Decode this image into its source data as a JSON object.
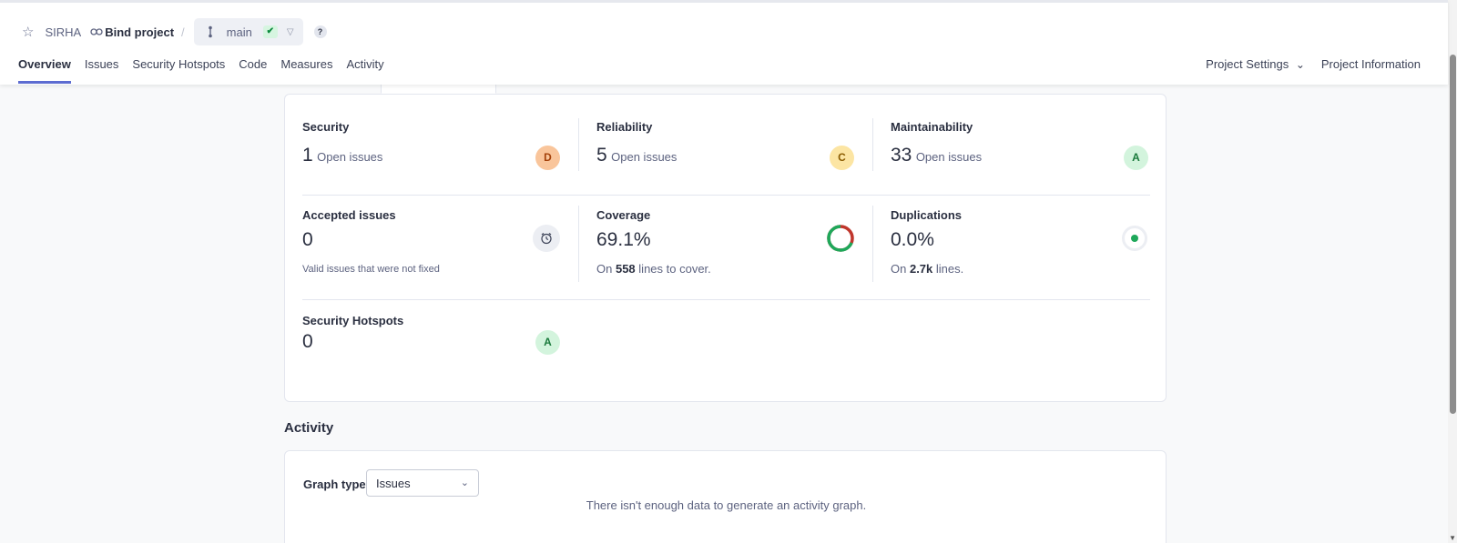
{
  "breadcrumb": {
    "project": "SIRHA",
    "bind_label": "Bind project",
    "separator": "/",
    "branch": "main",
    "qg_status_mark": "✔",
    "help": "?"
  },
  "nav": {
    "tabs": [
      "Overview",
      "Issues",
      "Security Hotspots",
      "Code",
      "Measures",
      "Activity"
    ],
    "active": "Overview",
    "right": {
      "settings": "Project Settings",
      "settings_chev": "⌄",
      "info": "Project Information"
    }
  },
  "metrics": {
    "security": {
      "title": "Security",
      "count": "1",
      "suffix": "Open issues",
      "rating": "D",
      "rating_color": "#f9c59b",
      "rating_text": "#a4410a"
    },
    "reliability": {
      "title": "Reliability",
      "count": "5",
      "suffix": "Open issues",
      "rating": "C",
      "rating_color": "#fce5a3",
      "rating_text": "#8a5b00"
    },
    "maintainability": {
      "title": "Maintainability",
      "count": "33",
      "suffix": "Open issues",
      "rating": "A",
      "rating_color": "#d3f4dd",
      "rating_text": "#1a7a3c"
    },
    "accepted": {
      "title": "Accepted issues",
      "value": "0",
      "note": "Valid issues that were not fixed"
    },
    "coverage": {
      "title": "Coverage",
      "value": "69.1%",
      "pre": "On",
      "lines": "558",
      "post": "lines to cover.",
      "percent": 69.1
    },
    "duplications": {
      "title": "Duplications",
      "value": "0.0%",
      "pre": "On",
      "lines": "2.7k",
      "post": "lines."
    },
    "hotspots": {
      "title": "Security Hotspots",
      "value": "0",
      "rating": "A"
    }
  },
  "activity": {
    "title": "Activity",
    "graph_type_label": "Graph type",
    "graph_type_value": "Issues",
    "no_data": "There isn't enough data to generate an activity graph."
  },
  "colors": {
    "accent": "#5d6cd1",
    "coverage_good": "#1ea85a",
    "coverage_bad": "#c0362c"
  },
  "icons": [
    "star-icon",
    "link-icon",
    "branch-icon",
    "check-icon",
    "chevron-down-icon",
    "help-icon",
    "alarm-clock-icon"
  ]
}
